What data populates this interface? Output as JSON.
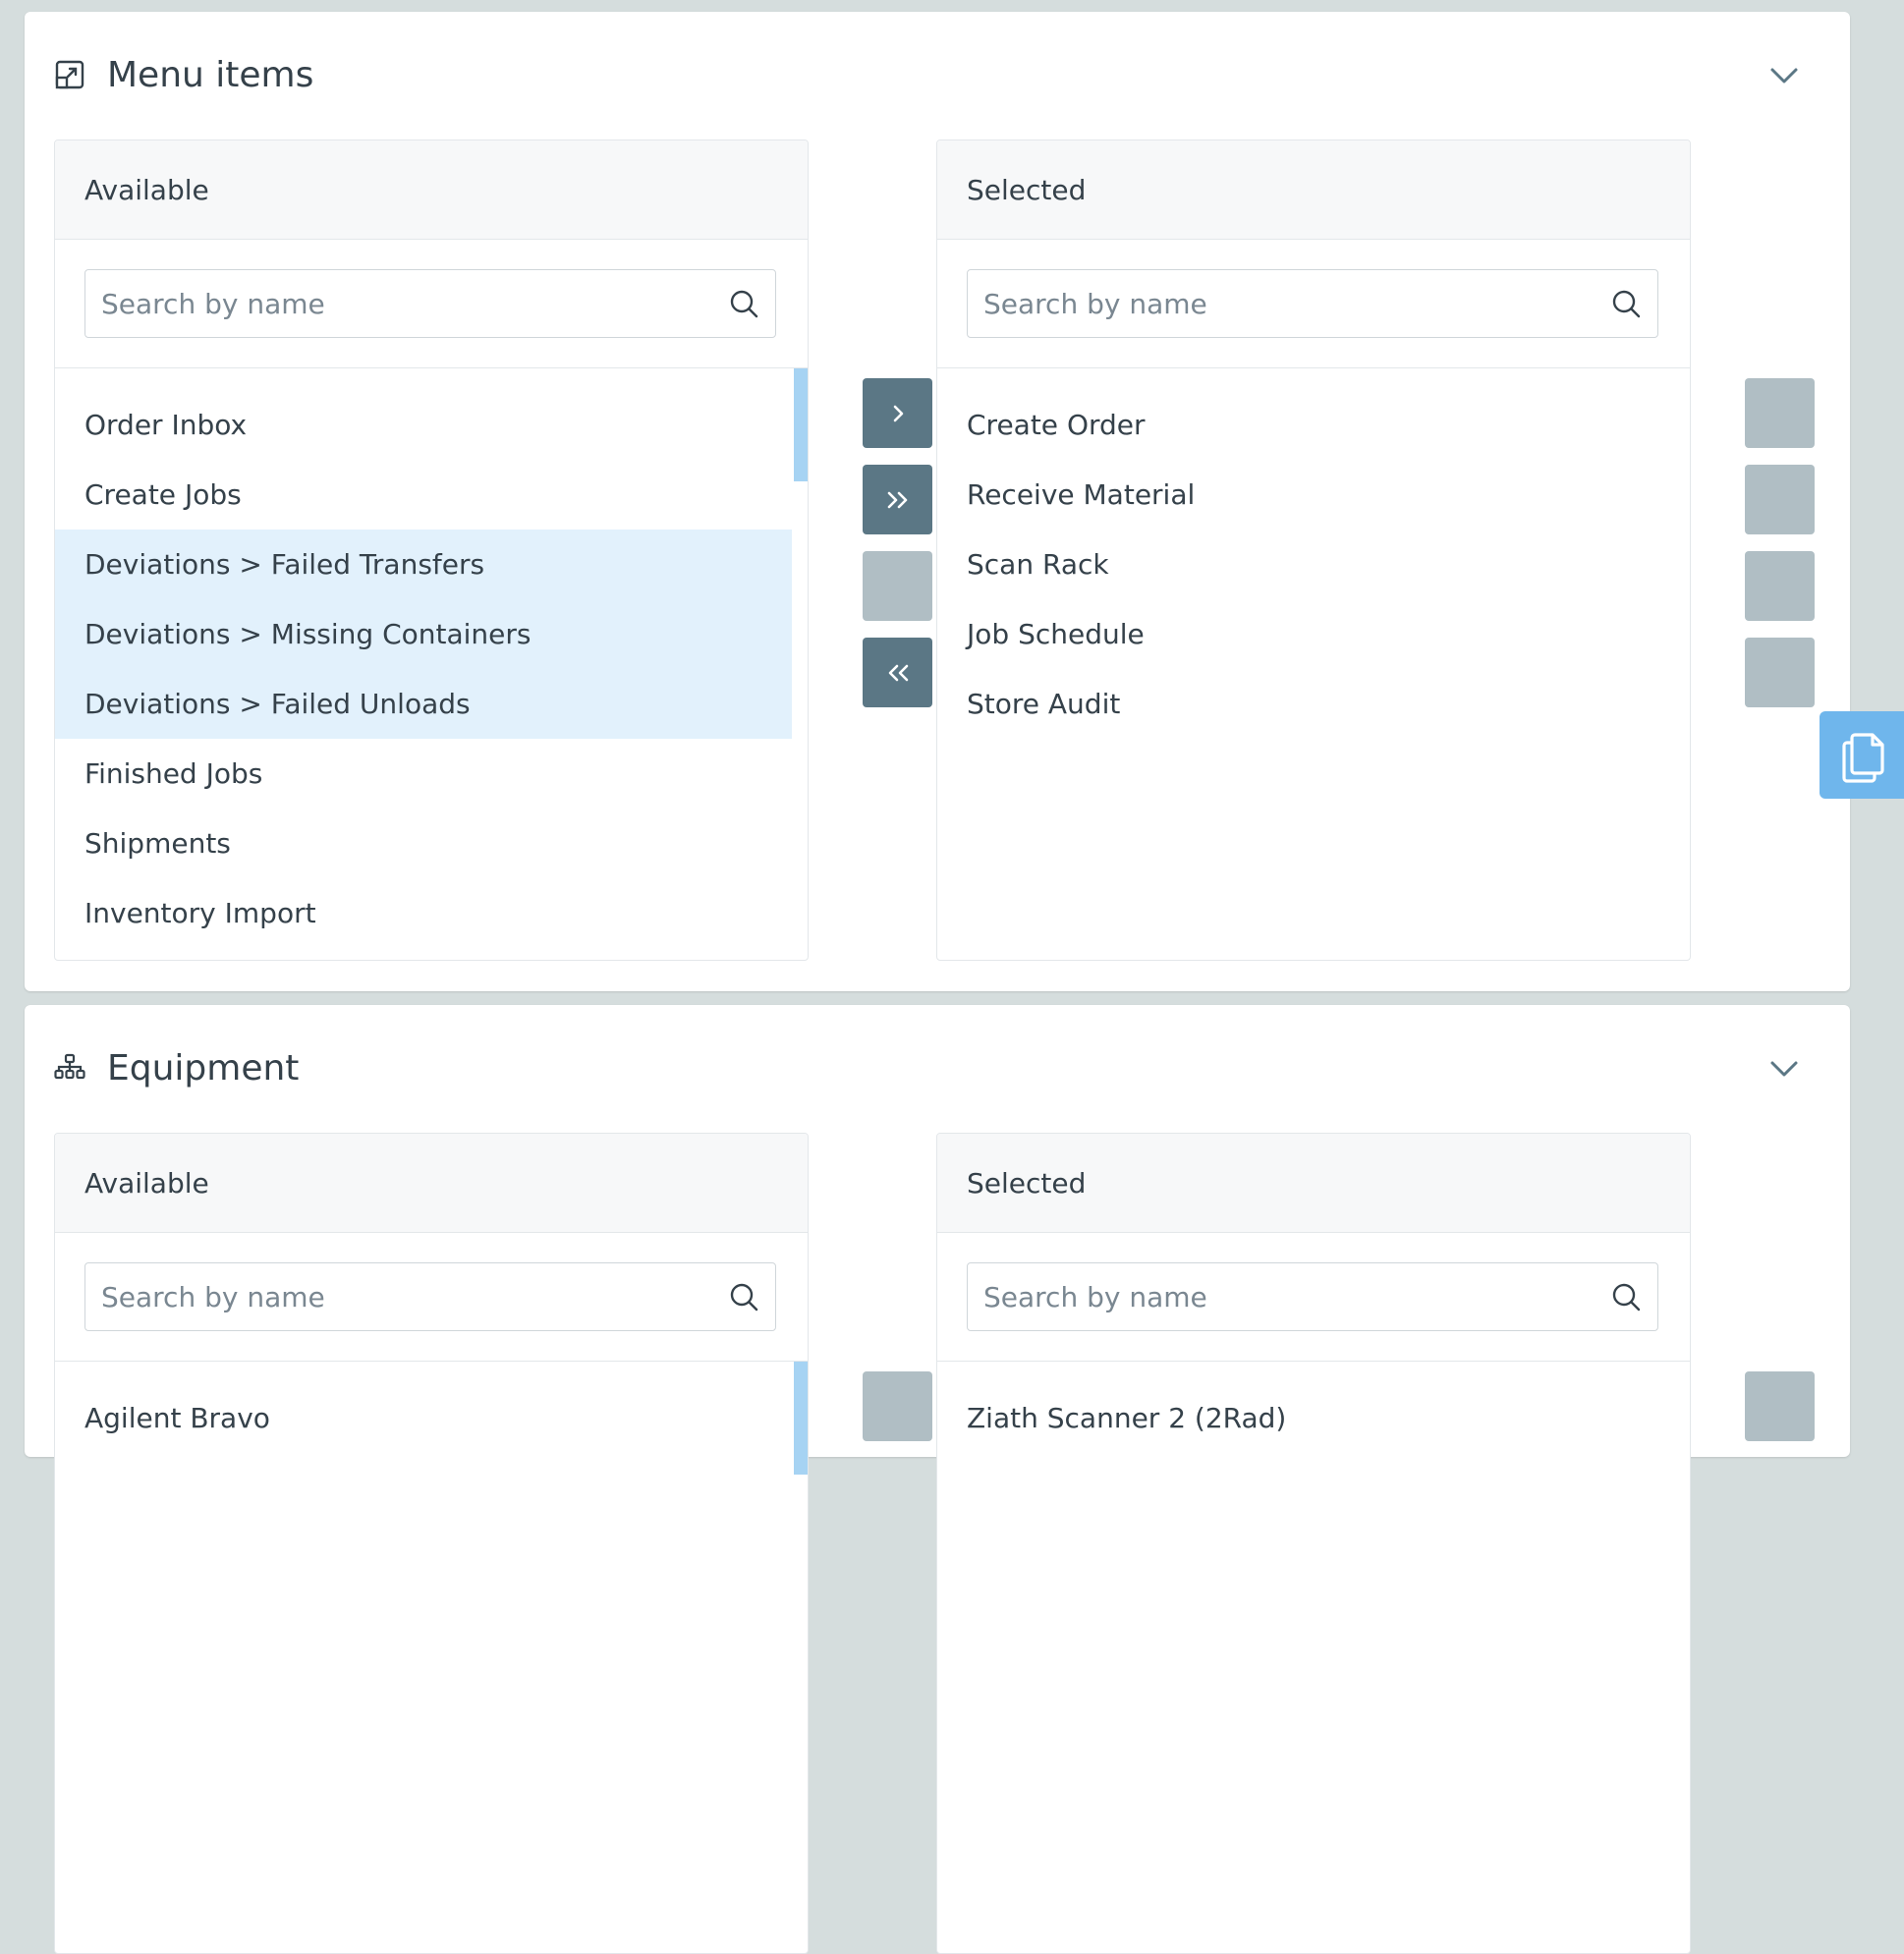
{
  "menu_section": {
    "title": "Menu items",
    "available": {
      "header": "Available",
      "search_placeholder": "Search by name",
      "items": [
        {
          "label": "Order Inbox",
          "selected": false
        },
        {
          "label": "Create Jobs",
          "selected": false
        },
        {
          "label": "Deviations > Failed Transfers",
          "selected": true
        },
        {
          "label": "Deviations > Missing Containers",
          "selected": true
        },
        {
          "label": "Deviations > Failed Unloads",
          "selected": true
        },
        {
          "label": "Finished Jobs",
          "selected": false
        },
        {
          "label": "Shipments",
          "selected": false
        },
        {
          "label": "Inventory Import",
          "selected": false
        }
      ]
    },
    "selected": {
      "header": "Selected",
      "search_placeholder": "Search by name",
      "items": [
        "Create Order",
        "Receive Material",
        "Scan Rack",
        "Job Schedule",
        "Store Audit"
      ]
    },
    "transfer_buttons": [
      {
        "glyph": "›",
        "enabled": true
      },
      {
        "glyph": "»",
        "enabled": true
      },
      {
        "glyph": "",
        "enabled": false
      },
      {
        "glyph": "«",
        "enabled": true
      }
    ]
  },
  "equipment_section": {
    "title": "Equipment",
    "available": {
      "header": "Available",
      "search_placeholder": "Search by name",
      "items": [
        "Agilent Bravo"
      ]
    },
    "selected": {
      "header": "Selected",
      "search_placeholder": "Search by name",
      "items": [
        "Ziath Scanner 2 (2Rad)"
      ]
    }
  },
  "colors": {
    "accent": "#5b7785",
    "disabled": "#b0bec4",
    "selection": "#e2f1fc",
    "float_button": "#6fb6ec"
  },
  "icons": {
    "menu_section": "external-link-square-icon",
    "equipment_section": "sitemap-icon",
    "search": "search-icon",
    "collapse": "chevron-down-icon",
    "float": "copy-icon"
  }
}
